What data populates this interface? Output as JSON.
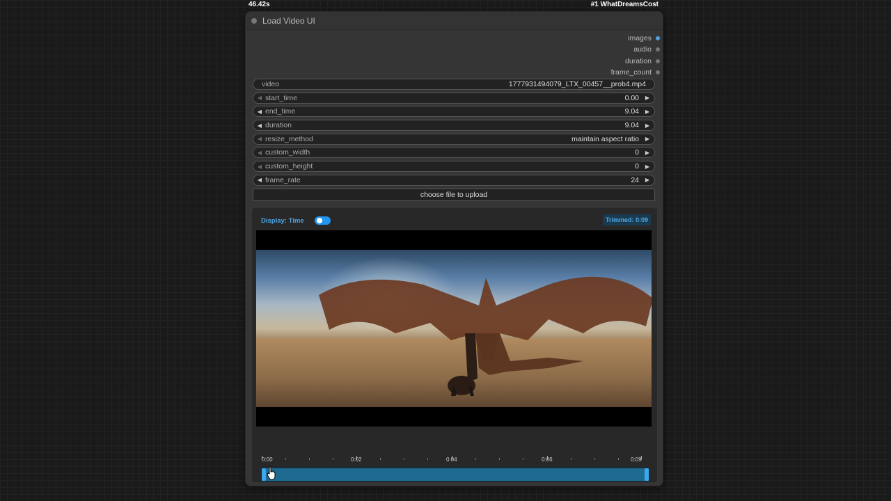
{
  "top_bar": {
    "time_text": "46.42s",
    "badge_text": "#1 WhatDreamsCost"
  },
  "node": {
    "title": "Load Video UI",
    "outputs": [
      {
        "label": "images",
        "active": true
      },
      {
        "label": "audio",
        "active": false
      },
      {
        "label": "duration",
        "active": false
      },
      {
        "label": "frame_count",
        "active": false
      }
    ],
    "widgets": {
      "video": {
        "label": "video",
        "value": "1777931494079_LTX_00457__prob4.mp4"
      },
      "start_time": {
        "label": "start_time",
        "value": "0.00"
      },
      "end_time": {
        "label": "end_time",
        "value": "9.04"
      },
      "duration": {
        "label": "duration",
        "value": "9.04"
      },
      "resize_method": {
        "label": "resize_method",
        "value": "maintain aspect ratio"
      },
      "custom_width": {
        "label": "custom_width",
        "value": "0"
      },
      "custom_height": {
        "label": "custom_height",
        "value": "0"
      },
      "frame_rate": {
        "label": "frame_rate",
        "value": "24"
      },
      "upload_button": "choose file to upload"
    }
  },
  "preview": {
    "display_label": "Display: Time",
    "toggle_on": true,
    "trimmed_label": "Trimmed: 0:09",
    "video_description_icon": "video-frame",
    "timeline_labels": [
      "0:00",
      "0:02",
      "0:04",
      "0:06",
      "0:09"
    ],
    "trim_start_fraction": 0.0,
    "trim_end_fraction": 1.0
  },
  "colors": {
    "accent": "#4fa6e6",
    "range_fill": "#1e6a91",
    "node_bg": "#353535",
    "canvas_bg": "#1a1a1a"
  }
}
